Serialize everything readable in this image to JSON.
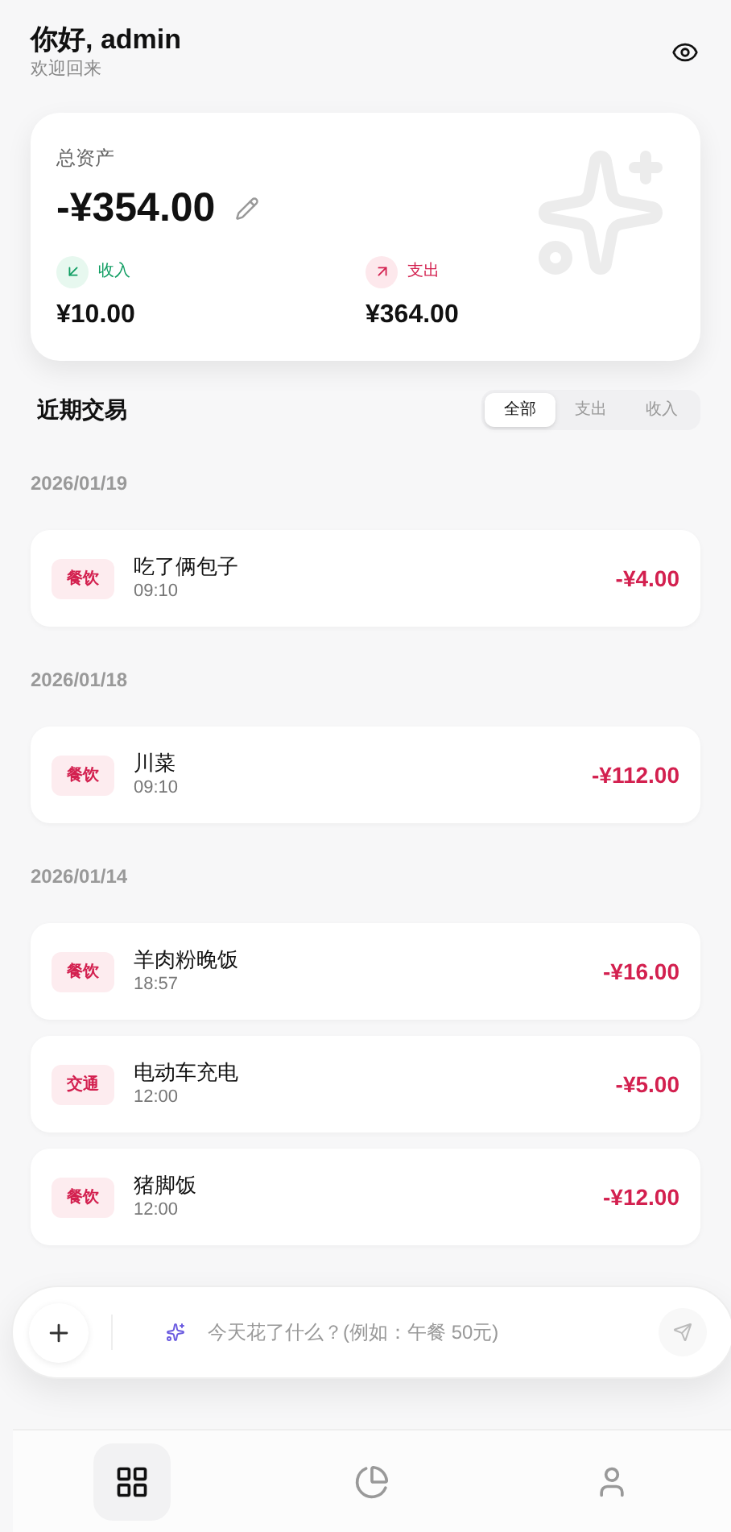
{
  "header": {
    "greeting": "你好, admin",
    "subtitle": "欢迎回来"
  },
  "summary": {
    "label": "总资产",
    "total": "-¥354.00",
    "income": {
      "label": "收入",
      "amount": "¥10.00"
    },
    "expense": {
      "label": "支出",
      "amount": "¥364.00"
    }
  },
  "transactions_header": {
    "title": "近期交易",
    "filters": [
      {
        "label": "全部",
        "selected": true
      },
      {
        "label": "支出",
        "selected": false
      },
      {
        "label": "收入",
        "selected": false
      }
    ]
  },
  "groups": [
    {
      "date": "2026/01/19",
      "items": [
        {
          "category": "餐饮",
          "title": "吃了俩包子",
          "time": "09:10",
          "amount": "-¥4.00"
        }
      ]
    },
    {
      "date": "2026/01/18",
      "items": [
        {
          "category": "餐饮",
          "title": "川菜",
          "time": "09:10",
          "amount": "-¥112.00"
        }
      ]
    },
    {
      "date": "2026/01/14",
      "items": [
        {
          "category": "餐饮",
          "title": "羊肉粉晚饭",
          "time": "18:57",
          "amount": "-¥16.00"
        },
        {
          "category": "交通",
          "title": "电动车充电",
          "time": "12:00",
          "amount": "-¥5.00"
        },
        {
          "category": "餐饮",
          "title": "猪脚饭",
          "time": "12:00",
          "amount": "-¥12.00"
        }
      ]
    }
  ],
  "input_bar": {
    "placeholder": "今天花了什么？(例如：午餐 50元)"
  },
  "nav": [
    {
      "kind": "home",
      "selected": true
    },
    {
      "kind": "stats",
      "selected": false
    },
    {
      "kind": "profile",
      "selected": false
    }
  ]
}
